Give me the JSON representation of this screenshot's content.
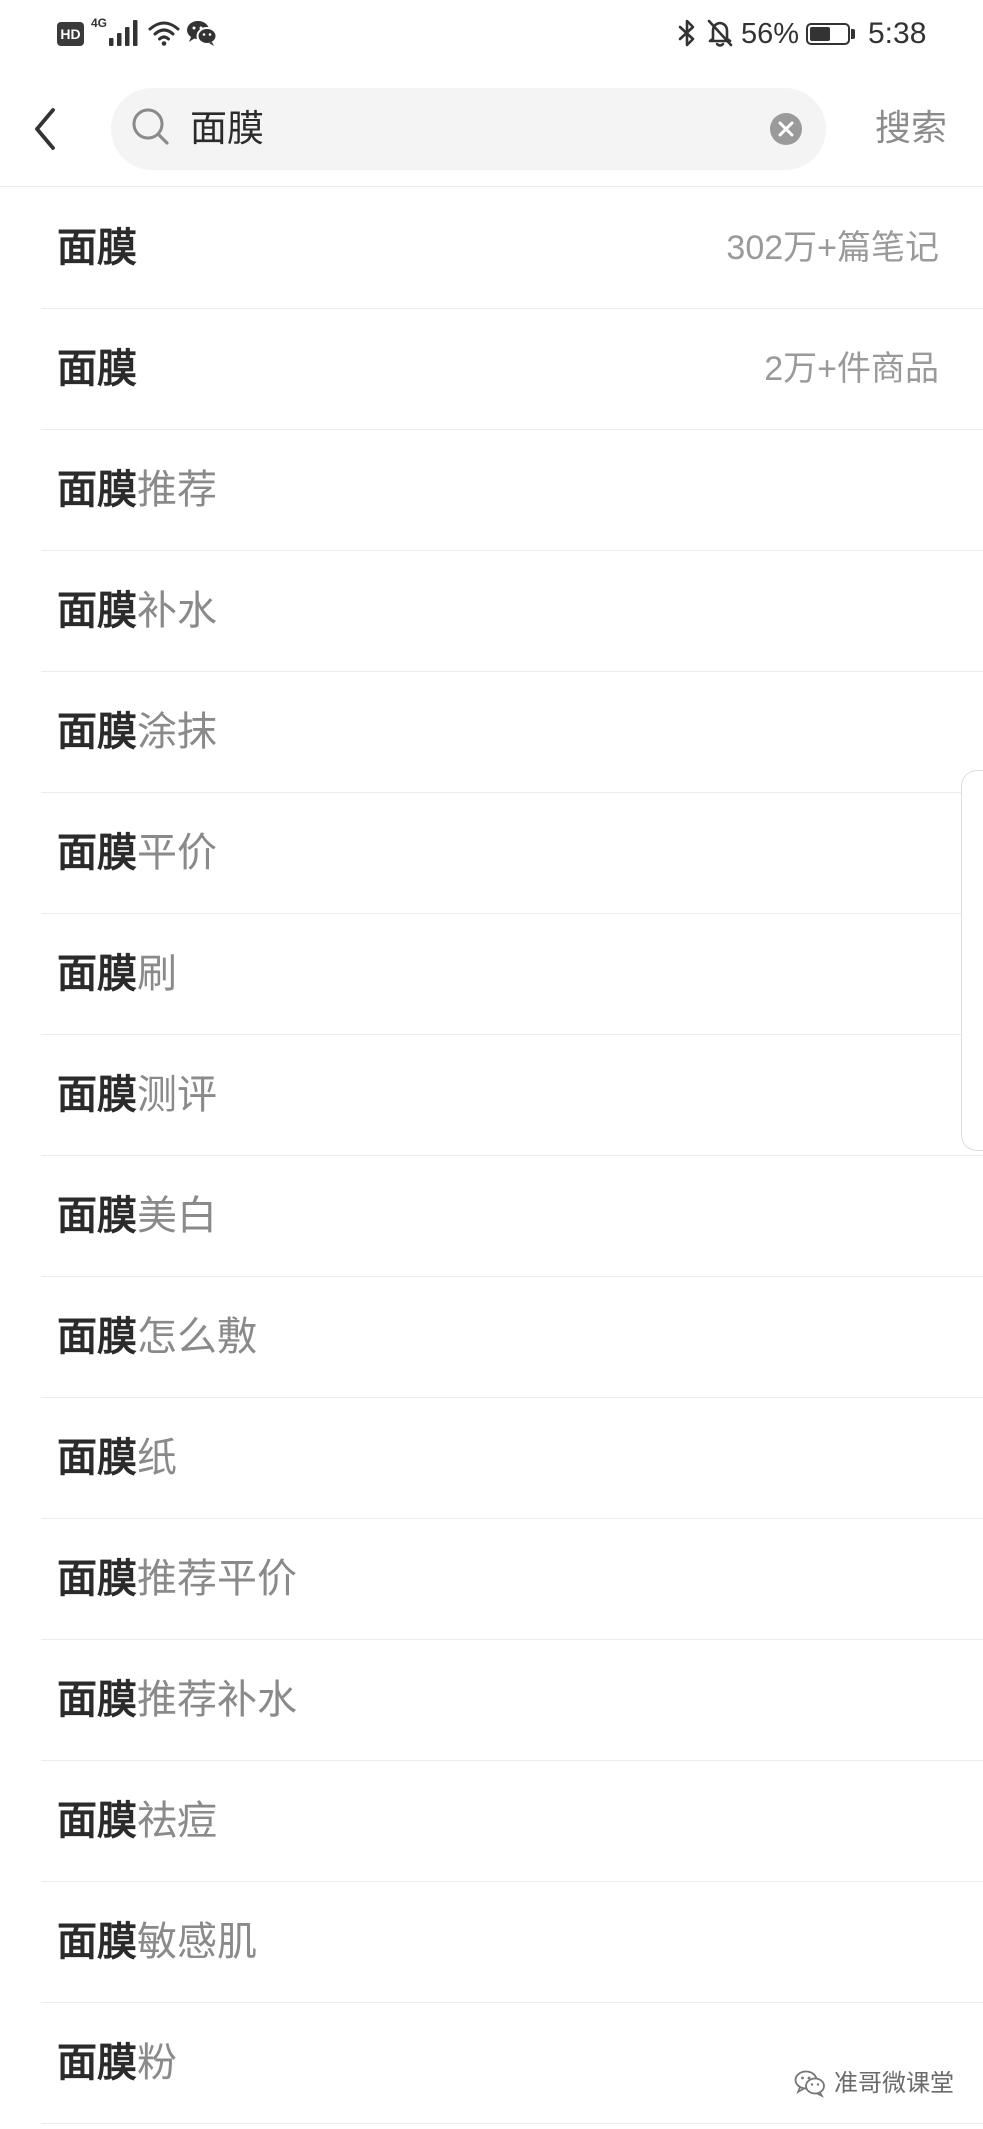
{
  "status_bar": {
    "hd_badge": "HD",
    "network_type": "4G",
    "battery_percent": "56%",
    "battery_fill": 0.56,
    "time": "5:38",
    "icons": [
      "signal-icon",
      "wifi-icon",
      "wechat-icon",
      "bluetooth-icon",
      "bell-off-icon",
      "battery-icon"
    ]
  },
  "header": {
    "back_icon": "back-chevron-icon",
    "search_icon": "search-icon",
    "search_query": "面膜",
    "clear_icon": "clear-icon",
    "search_button_label": "搜索"
  },
  "suggestions": [
    {
      "match": "面膜",
      "meta": "302万+篇笔记"
    },
    {
      "match": "面膜",
      "meta": "2万+件商品"
    },
    {
      "match": "面膜",
      "suffix": "推荐"
    },
    {
      "match": "面膜",
      "suffix": "补水"
    },
    {
      "match": "面膜",
      "suffix": "涂抹"
    },
    {
      "match": "面膜",
      "suffix": "平价"
    },
    {
      "match": "面膜",
      "suffix": "刷"
    },
    {
      "match": "面膜",
      "suffix": "测评"
    },
    {
      "match": "面膜",
      "suffix": "美白"
    },
    {
      "match": "面膜",
      "suffix": "怎么敷"
    },
    {
      "match": "面膜",
      "suffix": "纸"
    },
    {
      "match": "面膜",
      "suffix": "推荐平价"
    },
    {
      "match": "面膜",
      "suffix": "推荐补水"
    },
    {
      "match": "面膜",
      "suffix": "祛痘"
    },
    {
      "match": "面膜",
      "suffix": "敏感肌"
    },
    {
      "match": "面膜",
      "suffix": "粉"
    }
  ],
  "watermark": {
    "icon": "wechat-icon",
    "text": "准哥微课堂"
  },
  "colors": {
    "text_primary": "#2b2b2b",
    "text_secondary": "#8a8a8a",
    "meta": "#9a9a9a",
    "divider": "#ececec",
    "search_bg": "#f4f4f4"
  }
}
